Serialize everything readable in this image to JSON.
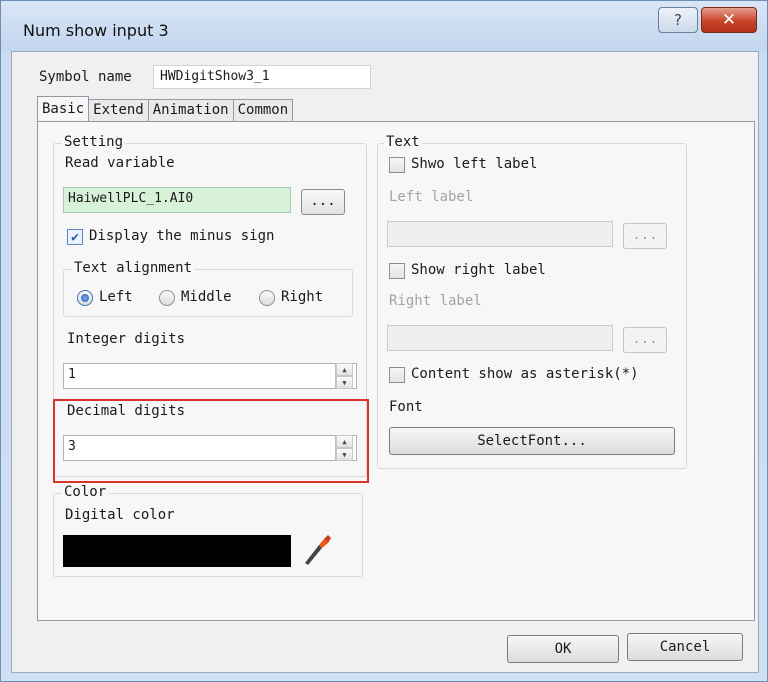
{
  "window": {
    "title": "Num show input 3",
    "help_glyph": "?",
    "close_glyph": "✕"
  },
  "symbol": {
    "label": "Symbol name",
    "value": "HWDigitShow3_1"
  },
  "tabs": [
    {
      "label": "Basic",
      "active": true
    },
    {
      "label": "Extend",
      "active": false
    },
    {
      "label": "Animation",
      "active": false
    },
    {
      "label": "Common",
      "active": false
    }
  ],
  "setting": {
    "title": "Setting",
    "read_variable_label": "Read variable",
    "read_variable_value": "HaiwellPLC_1.AI0",
    "browse_label": "...",
    "minus_sign": {
      "label": "Display the minus sign",
      "checked": true
    },
    "alignment": {
      "title": "Text alignment",
      "options": [
        {
          "label": "Left",
          "selected": true
        },
        {
          "label": "Middle",
          "selected": false
        },
        {
          "label": "Right",
          "selected": false
        }
      ]
    },
    "integer_digits": {
      "label": "Integer digits",
      "value": "1"
    },
    "decimal_digits": {
      "label": "Decimal digits",
      "value": "3"
    }
  },
  "color": {
    "title": "Color",
    "digital_label": "Digital color",
    "digital_color": "#000000"
  },
  "text": {
    "title": "Text",
    "show_left": {
      "label": "Shwo left label",
      "checked": false
    },
    "left_label_caption": "Left label",
    "left_label_value": "",
    "left_browse": "...",
    "show_right": {
      "label": "Show right label",
      "checked": false
    },
    "right_label_caption": "Right label",
    "right_label_value": "",
    "right_browse": "...",
    "asterisk": {
      "label": "Content show as asterisk(*)",
      "checked": false
    },
    "font_label": "Font",
    "select_font_button": "SelectFont..."
  },
  "footer": {
    "ok": "OK",
    "cancel": "Cancel"
  },
  "colors": {
    "highlight_border": "#d8322d",
    "read_var_bg": "#d8f2da",
    "close_button": "#c8432a"
  }
}
